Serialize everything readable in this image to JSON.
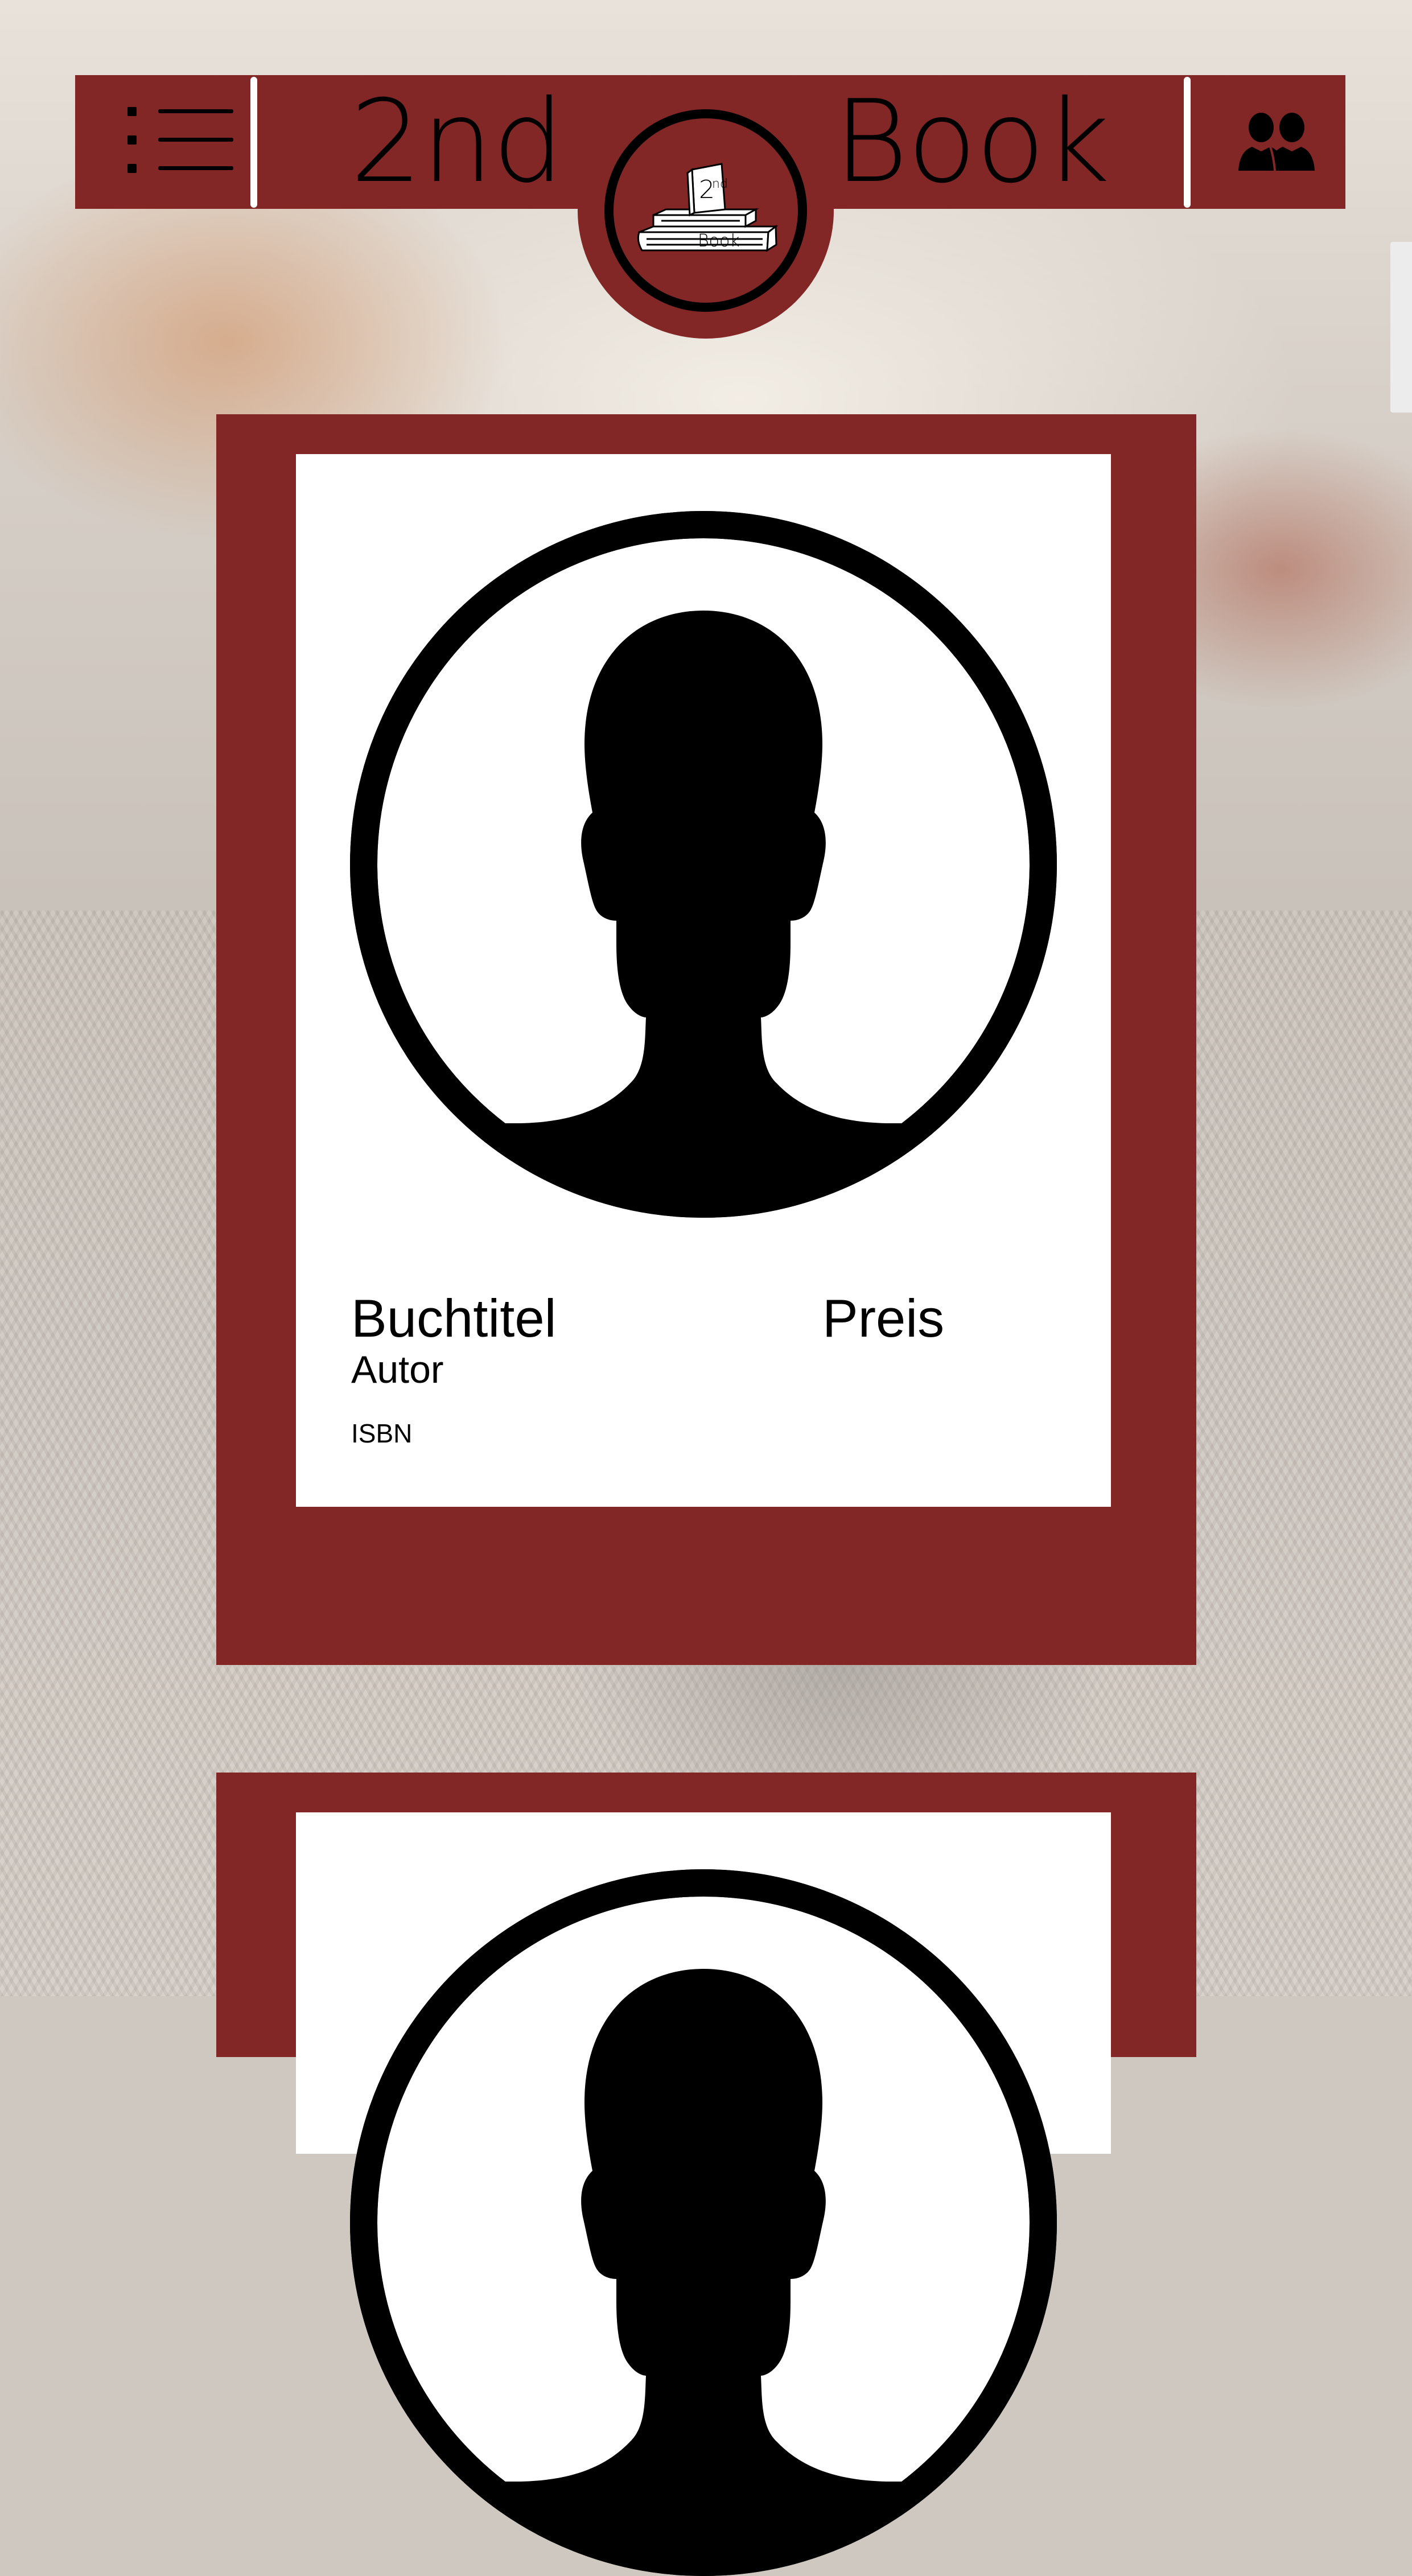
{
  "header": {
    "brand_left": "2nd",
    "brand_right": "Book",
    "logo": {
      "badge_top": "2nd",
      "badge_bottom": "Book"
    },
    "menu_icon": "menu-list-icon",
    "users_icon": "users-icon"
  },
  "colors": {
    "brand_red": "#822626",
    "card_white": "#ffffff",
    "text": "#000000"
  },
  "books": [
    {
      "title": "Buchtitel",
      "price": "Preis",
      "author": "Autor",
      "isbn": "ISBN",
      "cover_icon": "avatar-placeholder-icon"
    },
    {
      "cover_icon": "avatar-placeholder-icon"
    }
  ]
}
